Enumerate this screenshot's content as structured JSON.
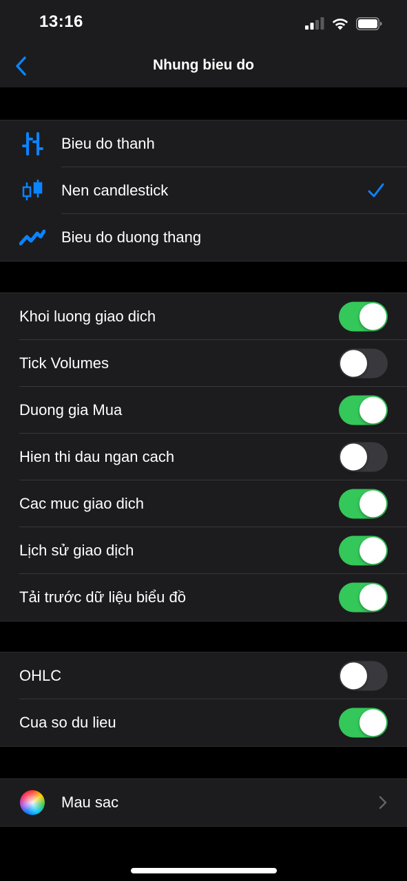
{
  "status_bar": {
    "time": "13:16",
    "icons": [
      "cellular-signal-icon",
      "wifi-icon",
      "battery-icon"
    ]
  },
  "nav": {
    "title": "Nhung bieu do",
    "back_icon": "chevron-left-icon"
  },
  "chart_types": [
    {
      "label": "Bieu do thanh",
      "icon": "bar-chart-icon",
      "selected": false
    },
    {
      "label": "Nen candlestick",
      "icon": "candlestick-icon",
      "selected": true
    },
    {
      "label": "Bieu do duong thang",
      "icon": "line-chart-icon",
      "selected": false
    }
  ],
  "display_options": [
    {
      "label": "Khoi luong giao dich",
      "on": true
    },
    {
      "label": "Tick Volumes",
      "on": false
    },
    {
      "label": "Duong gia Mua",
      "on": true
    },
    {
      "label": "Hien thi dau ngan cach",
      "on": false
    },
    {
      "label": "Cac muc giao dich",
      "on": true
    },
    {
      "label": "Lịch sử giao dịch",
      "on": true
    },
    {
      "label": "Tải trước dữ liệu biểu đồ",
      "on": true
    }
  ],
  "window_options": [
    {
      "label": "OHLC",
      "on": false
    },
    {
      "label": "Cua so du lieu",
      "on": true
    }
  ],
  "colors_row": {
    "label": "Mau sac",
    "icon": "color-wheel-icon"
  },
  "colors": {
    "accent": "#0a84ff",
    "toggle_on": "#34c759",
    "toggle_off": "#39393d",
    "group_bg": "#1c1c1e",
    "page_bg": "#000000"
  }
}
